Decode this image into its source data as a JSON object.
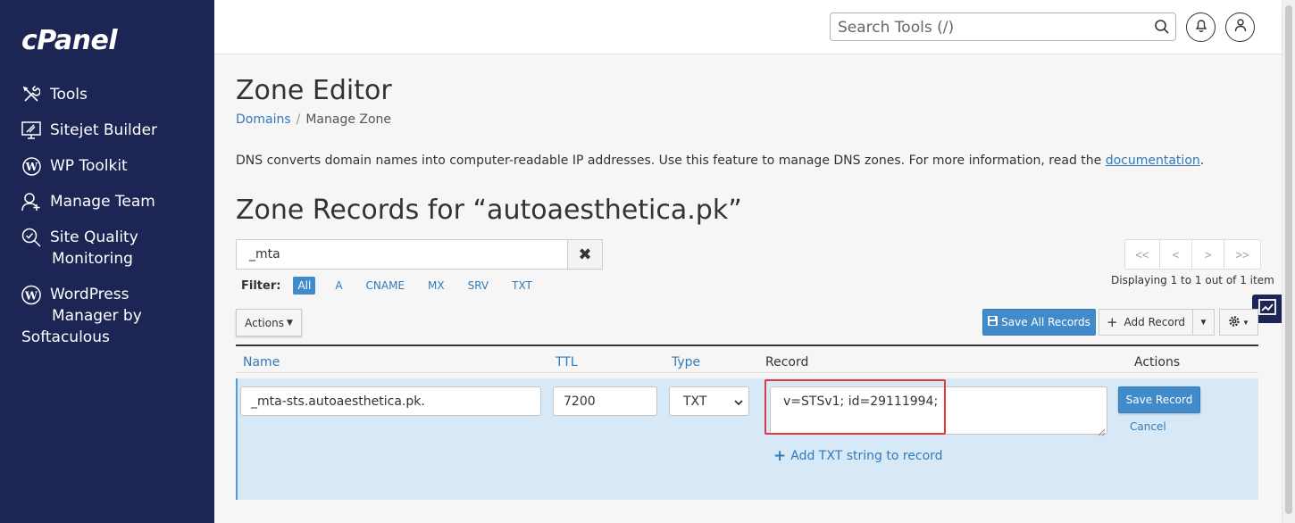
{
  "brand": {
    "logo": "cPanel"
  },
  "sidebar": {
    "items": [
      {
        "label": "Tools",
        "icon": "tools-icon"
      },
      {
        "label": "Sitejet Builder",
        "icon": "sitejet-icon"
      },
      {
        "label": "WP Toolkit",
        "icon": "wordpress-icon"
      },
      {
        "label": "Manage Team",
        "icon": "team-icon"
      },
      {
        "label_line1": "Site Quality",
        "label_line2": "Monitoring",
        "icon": "site-quality-icon"
      },
      {
        "label_line1": "WordPress",
        "label_line2": "Manager by",
        "label_line3": "Softaculous",
        "icon": "wordpress-icon"
      }
    ]
  },
  "topbar": {
    "search_placeholder": "Search Tools (/)"
  },
  "page": {
    "title": "Zone Editor",
    "breadcrumb": {
      "parent": "Domains",
      "sep": "/",
      "current": "Manage Zone"
    },
    "description": "DNS converts domain names into computer-readable IP addresses. Use this feature to manage DNS zones. For more information, read the ",
    "description_link": "documentation",
    "description_end": ".",
    "zone_title": "Zone Records for “autoaesthetica.pk”"
  },
  "filter": {
    "search_value": "_mta",
    "label": "Filter:",
    "options": [
      "All",
      "A",
      "CNAME",
      "MX",
      "SRV",
      "TXT"
    ],
    "active": "All"
  },
  "pager": {
    "buttons": [
      "<<",
      "<",
      ">",
      ">>"
    ],
    "status": "Displaying 1 to 1 out of 1 item"
  },
  "toolbar": {
    "actions_label": "Actions",
    "save_all_label": "Save All Records",
    "add_record_label": "Add Record"
  },
  "table": {
    "columns": {
      "name": "Name",
      "ttl": "TTL",
      "type": "Type",
      "record": "Record",
      "actions": "Actions"
    }
  },
  "edit_row": {
    "name": "_mta-sts.autoaesthetica.pk.",
    "ttl": "7200",
    "type": "TXT",
    "record": "v=STSv1; id=29111994;",
    "add_txt_label": "Add TXT string to record",
    "save_label": "Save Record",
    "cancel_label": "Cancel"
  },
  "colors": {
    "sidebar": "#1c2554",
    "primary": "#428bca",
    "link": "#337ab7",
    "highlight": "#e03a3a",
    "edit_row": "#d7e8f7"
  }
}
